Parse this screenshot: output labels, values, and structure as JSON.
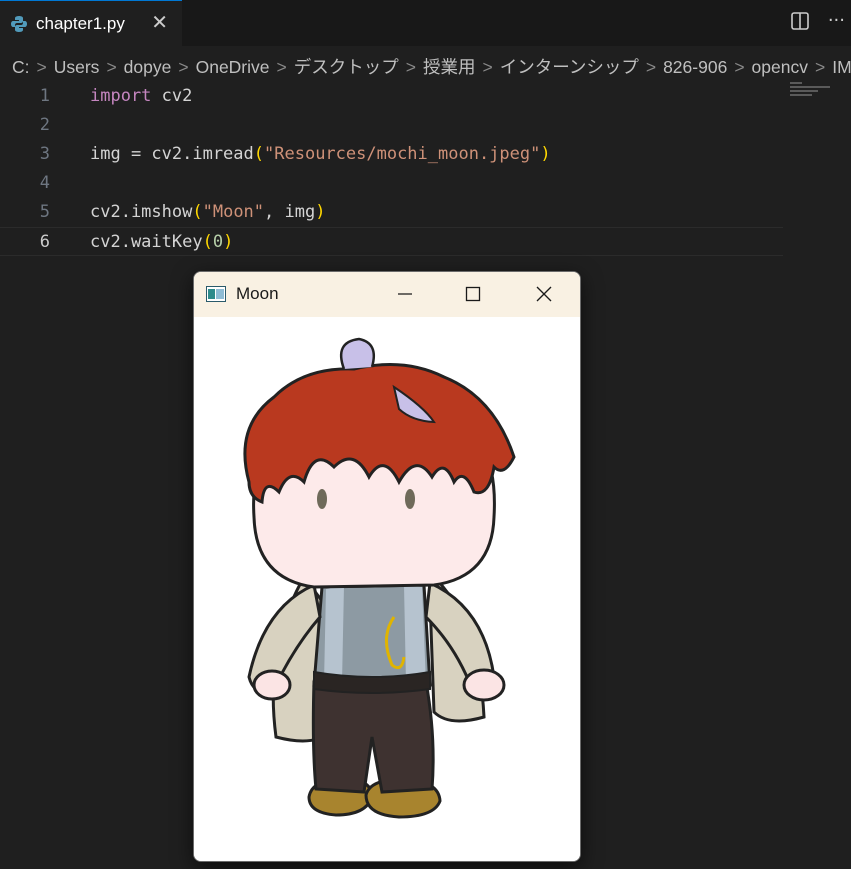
{
  "tab": {
    "filename": "chapter1.py",
    "close_glyph": "✕"
  },
  "tab_actions": {
    "split": "split-editor-icon",
    "more": "···"
  },
  "breadcrumb": [
    "C:",
    "Users",
    "dopye",
    "OneDrive",
    "デスクトップ",
    "授業用",
    "インターンシップ",
    "826-906",
    "opencv",
    "IMD"
  ],
  "code": {
    "lines": [
      {
        "n": "1",
        "tokens": [
          [
            "kw",
            "import"
          ],
          [
            "p",
            " cv2"
          ]
        ]
      },
      {
        "n": "2",
        "tokens": []
      },
      {
        "n": "3",
        "tokens": [
          [
            "p",
            "img = cv2.imread"
          ],
          [
            "br1",
            "("
          ],
          [
            "str",
            "\"Resources/mochi_moon.jpeg\""
          ],
          [
            "br1",
            ")"
          ]
        ]
      },
      {
        "n": "4",
        "tokens": []
      },
      {
        "n": "5",
        "tokens": [
          [
            "p",
            "cv2.imshow"
          ],
          [
            "br1",
            "("
          ],
          [
            "str",
            "\"Moon\""
          ],
          [
            "p",
            ", img"
          ],
          [
            "br1",
            ")"
          ]
        ]
      },
      {
        "n": "6",
        "tokens": [
          [
            "p",
            "cv2.waitKey"
          ],
          [
            "br1",
            "("
          ],
          [
            "num",
            "0"
          ],
          [
            "br1",
            ")"
          ]
        ]
      }
    ],
    "active_line": "6"
  },
  "window": {
    "title": "Moon",
    "minimize": "—",
    "maximize": "☐",
    "close": "✕"
  },
  "colors": {
    "editor_bg": "#1f1f1f",
    "keyword": "#c586c0",
    "string": "#ce9178",
    "number": "#b5cea8",
    "bracket": "#ffd700",
    "window_title_bg": "#f9f1e3"
  }
}
